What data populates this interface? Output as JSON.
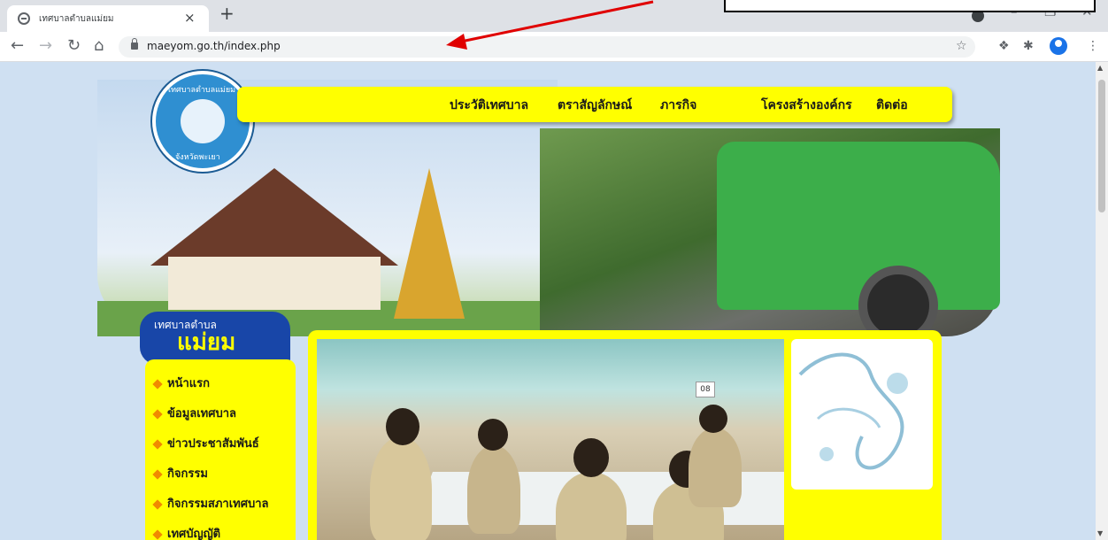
{
  "browser": {
    "tab_title": "เทศบาลตำบลแม่ยม",
    "tab_close": "×",
    "new_tab": "+",
    "url": "maeyom.go.th/index.php",
    "window_controls": [
      "–",
      "❐",
      "✕"
    ]
  },
  "site": {
    "menu": [
      "ประวัติเทศบาล",
      "ตราสัญลักษณ์",
      "ภารกิจ",
      "โครงสร้างองค์กร",
      "ติดต่อ"
    ],
    "logo_top": "เทศบาลตำบลแม่ยม",
    "logo_bottom": "จังหวัดพะเยา",
    "ribbon_small": "เทศบาลตำบล",
    "ribbon_big": "แม่ยม",
    "sidebar": [
      "หน้าแรก",
      "ข้อมูลเทศบาล",
      "ข่าวประชาสัมพันธ์",
      "กิจกรรม",
      "กิจกรรมสภาเทศบาล",
      "เทศบัญญัติ"
    ],
    "slide_counter": "08"
  },
  "colors": {
    "menu_yellow": "#ffff00",
    "ribbon_blue": "#1846a8",
    "annotation_arrow": "#e00000"
  }
}
